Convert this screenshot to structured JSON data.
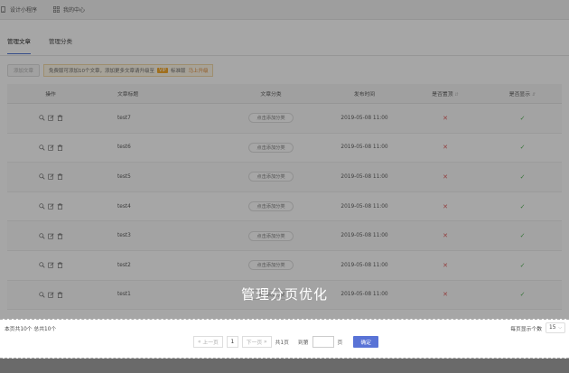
{
  "topbar": {
    "items": [
      {
        "label": "设计小程序",
        "icon": "mobile-icon"
      },
      {
        "label": "我的中心",
        "icon": "grid-icon"
      }
    ]
  },
  "tabs": [
    {
      "label": "管理文章",
      "active": true
    },
    {
      "label": "管理分类",
      "active": false
    }
  ],
  "toolbar": {
    "add_label": "添加文章",
    "notice_text": "免费版可添加10个文章，添加更多文章请升级至",
    "upgrade_tag": "VIP",
    "upgrade_text": "标准版",
    "upgrade_link": "马上升级"
  },
  "table": {
    "headers": [
      "操作",
      "文章标题",
      "文章分类",
      "发布时间",
      "是否置顶",
      "是否显示"
    ],
    "sort_icon": "sort-icon",
    "rows": [
      {
        "title": "test7",
        "category": "点击添加分类",
        "time": "2019-05-08 11:00",
        "top": false,
        "visible": true
      },
      {
        "title": "test6",
        "category": "点击添加分类",
        "time": "2019-05-08 11:00",
        "top": false,
        "visible": true
      },
      {
        "title": "test5",
        "category": "点击添加分类",
        "time": "2019-05-08 11:00",
        "top": false,
        "visible": true
      },
      {
        "title": "test4",
        "category": "点击添加分类",
        "time": "2019-05-08 11:00",
        "top": false,
        "visible": true
      },
      {
        "title": "test3",
        "category": "点击添加分类",
        "time": "2019-05-08 11:00",
        "top": false,
        "visible": true
      },
      {
        "title": "test2",
        "category": "点击添加分类",
        "time": "2019-05-08 11:00",
        "top": false,
        "visible": true
      },
      {
        "title": "test1",
        "category": "点击添加分类",
        "time": "2019-05-08 11:00",
        "top": false,
        "visible": true
      }
    ]
  },
  "overlay": {
    "title": "管理分页优化"
  },
  "footer": {
    "total_text": "本页共10个  总共10个",
    "per_page_label": "每页显示个数",
    "per_page_value": "15",
    "prev_label": "上一页",
    "current_page": "1",
    "next_label": "下一页",
    "total_pages": "共1页",
    "goto_label": "到第",
    "page_unit": "页",
    "confirm_label": "确定"
  },
  "colors": {
    "accent": "#5973d6",
    "cross": "#e05a5a",
    "check": "#4caf50",
    "upgrade": "#f5a623"
  }
}
